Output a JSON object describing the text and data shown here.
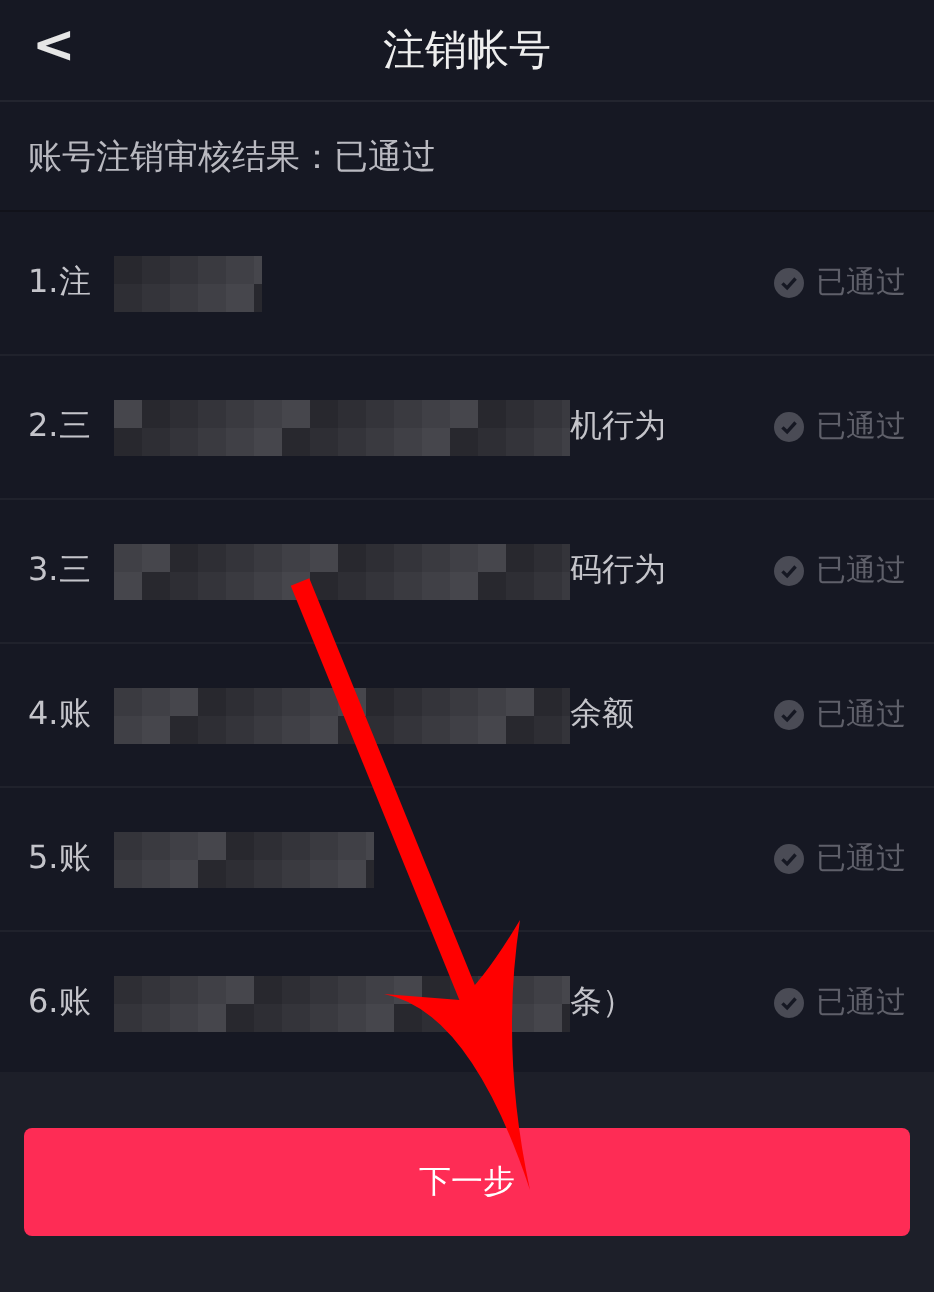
{
  "header": {
    "back": "<",
    "title": "注销帐号"
  },
  "result": "账号注销审核结果：已通过",
  "items": [
    {
      "prefix": "1.注",
      "status": "已通过",
      "passed": true
    },
    {
      "prefix": "2.三",
      "suffix": "机行为",
      "status": "已通过",
      "passed": true
    },
    {
      "prefix": "3.三",
      "suffix": "码行为",
      "status": "已通过",
      "passed": true
    },
    {
      "prefix": "4.账",
      "suffix": "余额",
      "status": "已通过",
      "passed": true
    },
    {
      "prefix": "5.账",
      "status": "已通过",
      "passed": true
    },
    {
      "prefix": "6.账",
      "suffix": "条）",
      "status": "已通过",
      "passed": true
    }
  ],
  "next_button": "下一步"
}
